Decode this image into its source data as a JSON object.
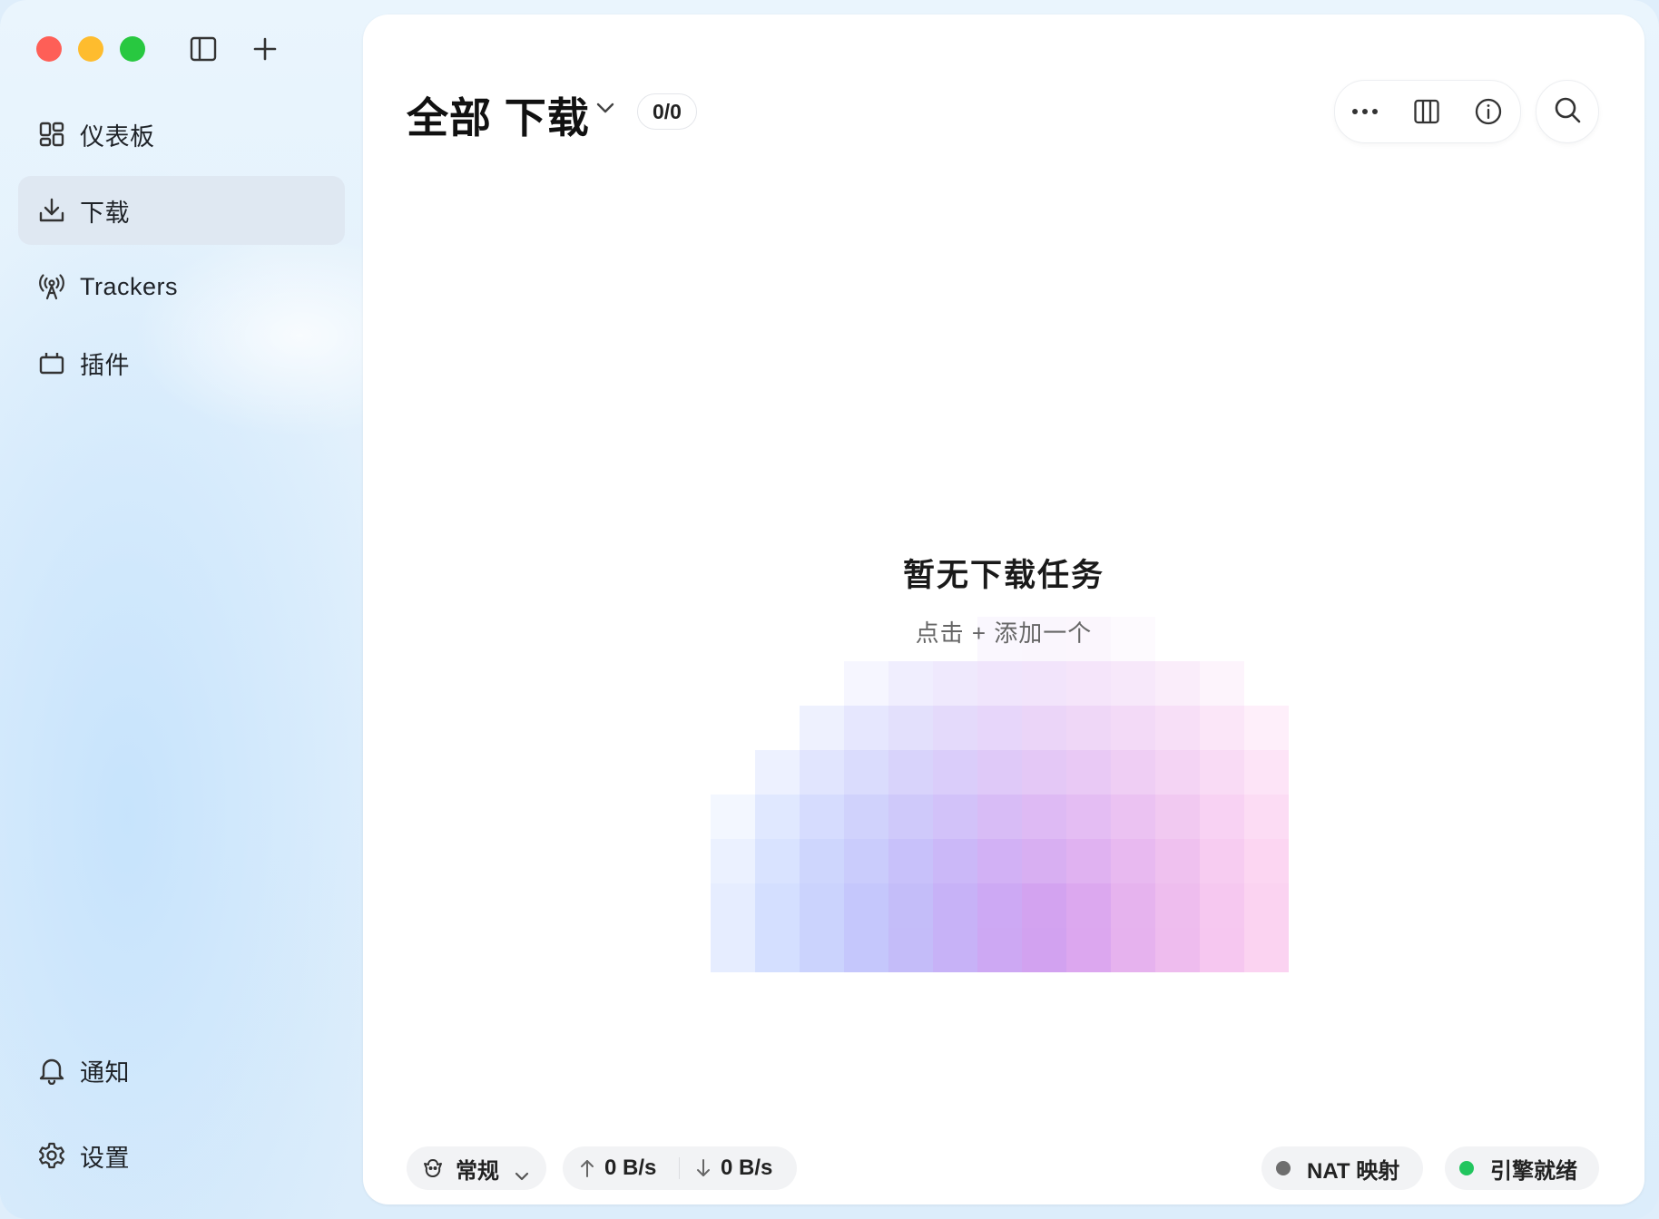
{
  "sidebar": {
    "items": [
      {
        "label": "仪表板",
        "icon": "dashboard-icon"
      },
      {
        "label": "下载",
        "icon": "download-icon",
        "active": true
      },
      {
        "label": "Trackers",
        "icon": "antenna-icon"
      },
      {
        "label": "插件",
        "icon": "plugin-icon"
      }
    ],
    "bottom": [
      {
        "label": "通知",
        "icon": "bell-icon"
      },
      {
        "label": "设置",
        "icon": "gear-icon"
      }
    ]
  },
  "header": {
    "title": "全部 下载",
    "count": "0/0"
  },
  "empty_state": {
    "title": "暂无下载任务",
    "subtitle": "点击 + 添加一个"
  },
  "status_bar": {
    "mode_label": "常规",
    "upload_speed": "0 B/s",
    "download_speed": "0 B/s",
    "nat_label": "NAT 映射",
    "nat_status_color": "#6e6e6e",
    "engine_label": "引擎就绪",
    "engine_status_color": "#22c55e"
  },
  "colors": {
    "traffic_red": "#fe5f57",
    "traffic_yellow": "#febc2e",
    "traffic_green": "#28c840"
  }
}
